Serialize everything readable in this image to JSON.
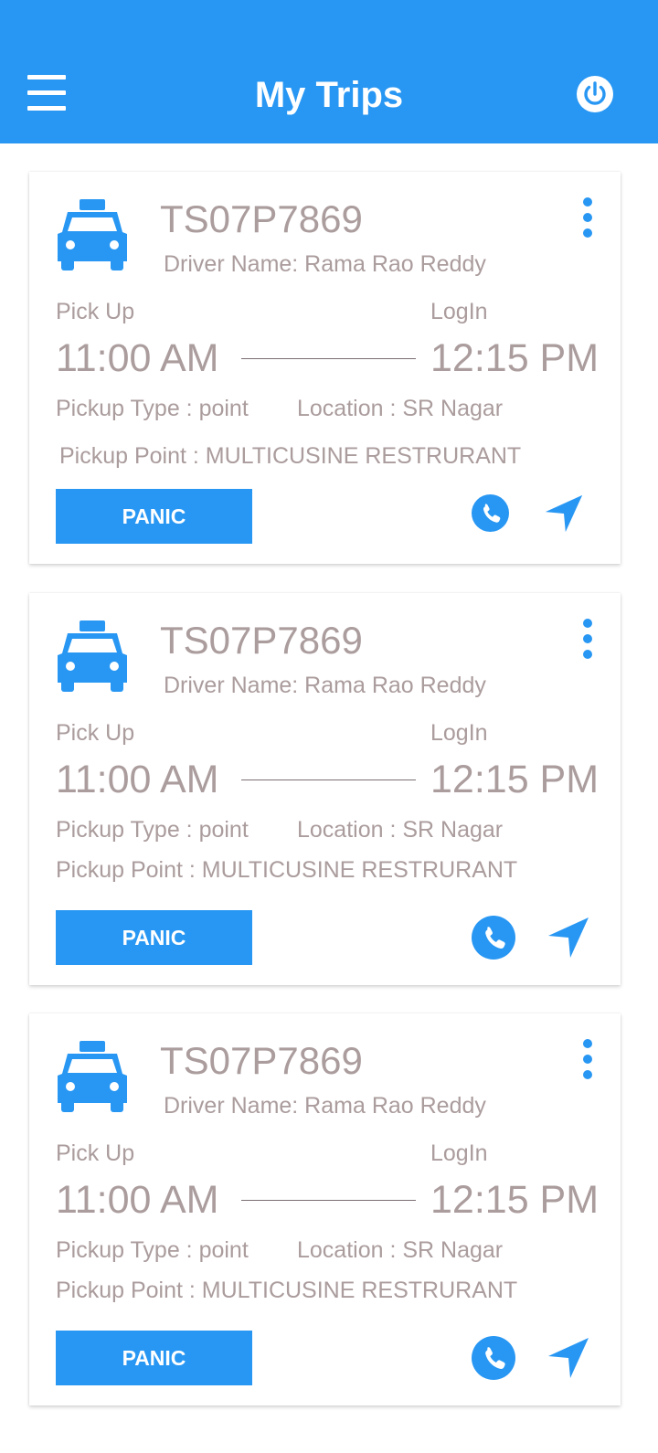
{
  "app_bar": {
    "title": "My Trips",
    "menu_icon": "menu-icon",
    "power_icon": "power-icon",
    "accent_color": "#2897f3"
  },
  "trips": [
    {
      "vehicle_number": "TS07P7869",
      "driver_name": "Driver Name: Rama Rao Reddy",
      "pickup_label": "Pick Up",
      "login_label": "LogIn",
      "pickup_time": "11:00 AM",
      "login_time": "12:15 PM",
      "pickup_type": "Pickup Type : point",
      "location": "Location : SR Nagar",
      "pickup_point": "Pickup Point : MULTICUSINE RESTRURANT",
      "panic_label": "PANIC"
    },
    {
      "vehicle_number": "TS07P7869",
      "driver_name": "Driver Name: Rama Rao Reddy",
      "pickup_label": "Pick Up",
      "login_label": "LogIn",
      "pickup_time": "11:00 AM",
      "login_time": "12:15 PM",
      "pickup_type": "Pickup Type : point",
      "location": "Location : SR Nagar",
      "pickup_point": "Pickup Point : MULTICUSINE RESTRURANT",
      "panic_label": "PANIC"
    },
    {
      "vehicle_number": "TS07P7869",
      "driver_name": "Driver Name: Rama Rao Reddy",
      "pickup_label": "Pick Up",
      "login_label": "LogIn",
      "pickup_time": "11:00 AM",
      "login_time": "12:15 PM",
      "pickup_type": "Pickup Type : point",
      "location": "Location : SR Nagar",
      "pickup_point": "Pickup Point : MULTICUSINE RESTRURANT",
      "panic_label": "PANIC"
    }
  ],
  "icons": {
    "vehicle": "taxi-icon",
    "more": "more-vertical-icon",
    "call": "phone-icon",
    "navigate": "navigation-icon"
  },
  "colors": {
    "primary": "#2897f3",
    "text_muted": "#ab9c9d",
    "card_bg": "#ffffff"
  }
}
